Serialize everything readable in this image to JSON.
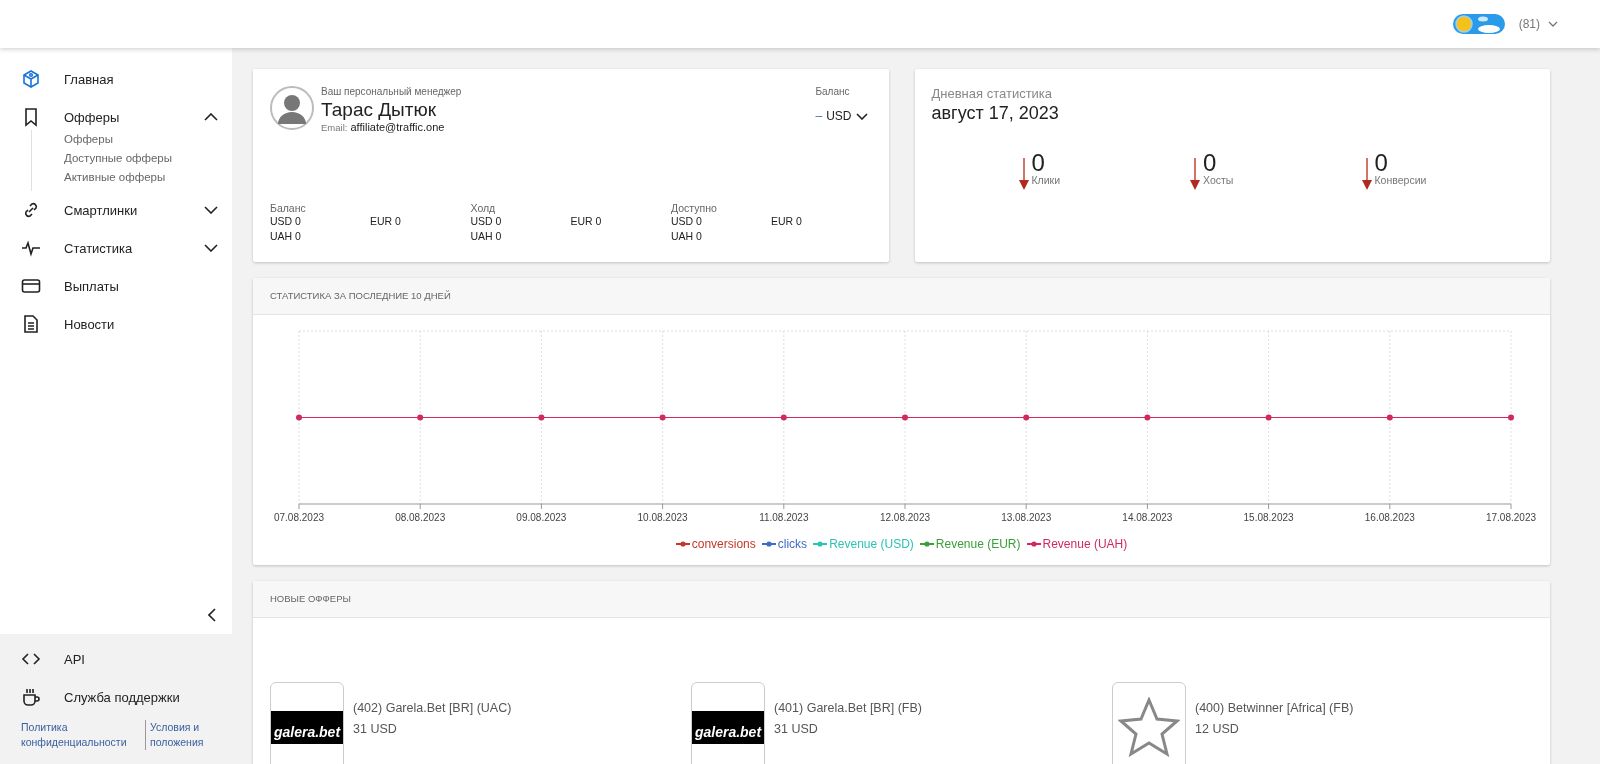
{
  "header": {
    "account_label": "(81)"
  },
  "sidebar": {
    "items": [
      {
        "label": "Главная",
        "selected": true
      },
      {
        "label": "Офферы",
        "selected": false,
        "expanded": true,
        "children": [
          {
            "label": "Офферы"
          },
          {
            "label": "Доступные офферы"
          },
          {
            "label": "Активные офферы"
          }
        ]
      },
      {
        "label": "Смартлинки",
        "selected": false,
        "expanded": false
      },
      {
        "label": "Статистика",
        "selected": false,
        "expanded": false
      },
      {
        "label": "Выплаты",
        "selected": false
      },
      {
        "label": "Новости",
        "selected": false
      }
    ],
    "bottom_items": [
      {
        "label": "API"
      },
      {
        "label": "Служба поддержки"
      }
    ],
    "footer_links": [
      "Политика конфиденциальности",
      "Условия и положения"
    ]
  },
  "manager": {
    "caption": "Ваш персональный менеджер",
    "name": "Тарас Дытюк",
    "email_label": "Email:",
    "email": "affiliate@traffic.one",
    "balance_label": "Баланс",
    "currency_dash": "–",
    "currency": "USD",
    "groups": [
      {
        "title": "Баланс",
        "values": [
          "USD 0",
          "EUR 0",
          "UAH 0"
        ]
      },
      {
        "title": "Холд",
        "values": [
          "USD 0",
          "EUR 0",
          "UAH 0"
        ]
      },
      {
        "title": "Доступно",
        "values": [
          "USD 0",
          "EUR 0",
          "UAH 0"
        ]
      }
    ]
  },
  "daily": {
    "title": "Дневная статистика",
    "date": "август 17, 2023",
    "stats": [
      {
        "value": "0",
        "label": "Клики"
      },
      {
        "value": "0",
        "label": "Хосты"
      },
      {
        "value": "0",
        "label": "Конверсии"
      }
    ]
  },
  "chart_panel": {
    "title": "СТАТИСТИКА ЗА ПОСЛЕДНИЕ 10 ДНЕЙ",
    "x_labels": [
      "07.08.2023",
      "08.08.2023",
      "09.08.2023",
      "10.08.2023",
      "11.08.2023",
      "12.08.2023",
      "13.08.2023",
      "14.08.2023",
      "15.08.2023",
      "16.08.2023",
      "17.08.2023"
    ],
    "legend": [
      {
        "name": "conversions",
        "color": "#c0392b"
      },
      {
        "name": "clicks",
        "color": "#3d6cc0"
      },
      {
        "name": "Revenue (USD)",
        "color": "#2cc3b5"
      },
      {
        "name": "Revenue (EUR)",
        "color": "#3a9e3a"
      },
      {
        "name": "Revenue (UAH)",
        "color": "#d12a5c"
      }
    ]
  },
  "offers_panel": {
    "title": "НОВЫЕ ОФФЕРЫ",
    "offers": [
      {
        "kind": "logo",
        "logo_text": "galera.bet",
        "name": "(402) Garela.Bet [BR] (UAC)",
        "payout": "31 USD"
      },
      {
        "kind": "logo",
        "logo_text": "galera.bet",
        "name": "(401) Garela.Bet [BR] (FB)",
        "payout": "31 USD"
      },
      {
        "kind": "placeholder",
        "name": "(400) Betwinner [Africa] (FB)",
        "payout": "12 USD"
      }
    ]
  }
}
